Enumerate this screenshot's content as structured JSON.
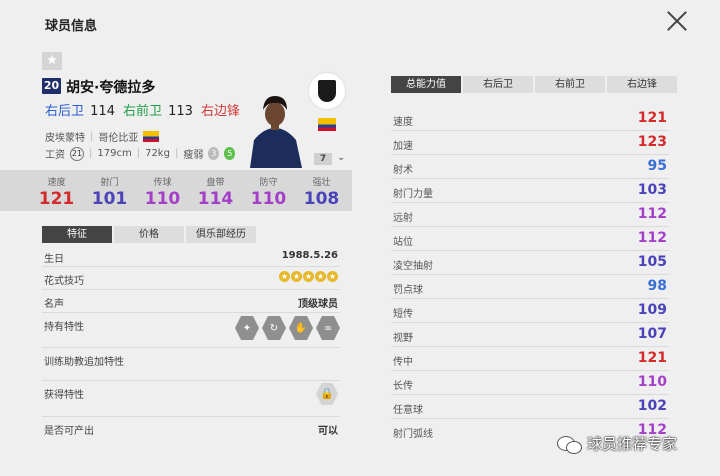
{
  "header": {
    "title": "球员信息"
  },
  "player": {
    "number": "20",
    "name": "胡安·夸德拉多",
    "positions": [
      {
        "label": "右后卫",
        "value": "114"
      },
      {
        "label": "右前卫",
        "value": "113"
      },
      {
        "label": "右边锋",
        "value": "112"
      }
    ],
    "club": "皮埃蒙特",
    "nationality": "哥伦比亚",
    "wage_label": "工资",
    "wage": "21",
    "height": "179cm",
    "weight": "72kg",
    "body_type": "瘦弱",
    "weak_foot": "3",
    "strong_foot": "5",
    "level": "7"
  },
  "stats": [
    {
      "label": "速度",
      "value": "121",
      "color": "#d32a2a"
    },
    {
      "label": "射门",
      "value": "101",
      "color": "#4a44b8"
    },
    {
      "label": "传球",
      "value": "110",
      "color": "#a43fc8"
    },
    {
      "label": "盘带",
      "value": "114",
      "color": "#a43fc8"
    },
    {
      "label": "防守",
      "value": "110",
      "color": "#a43fc8"
    },
    {
      "label": "强壮",
      "value": "108",
      "color": "#4a44b8"
    }
  ],
  "left_tabs": [
    "特征",
    "价格",
    "俱乐部经历"
  ],
  "details": {
    "birthday_label": "生日",
    "birthday": "1988.5.26",
    "skill_label": "花式技巧",
    "skill_stars": 5,
    "reputation_label": "名声",
    "reputation": "顶级球员",
    "traits_label": "持有特性",
    "coach_traits_label": "训练助教追加特性",
    "obtain_label": "获得特性",
    "producible_label": "是否可产出",
    "producible": "可以"
  },
  "right_tabs": [
    "总能力值",
    "右后卫",
    "右前卫",
    "右边锋"
  ],
  "attributes": [
    {
      "label": "速度",
      "value": "121",
      "color": "#d32a2a"
    },
    {
      "label": "加速",
      "value": "123",
      "color": "#d32a2a"
    },
    {
      "label": "射术",
      "value": "95",
      "color": "#3a6fd8"
    },
    {
      "label": "射门力量",
      "value": "103",
      "color": "#4a44b8"
    },
    {
      "label": "远射",
      "value": "112",
      "color": "#a43fc8"
    },
    {
      "label": "站位",
      "value": "112",
      "color": "#a43fc8"
    },
    {
      "label": "凌空抽射",
      "value": "105",
      "color": "#4a44b8"
    },
    {
      "label": "罚点球",
      "value": "98",
      "color": "#3a6fd8"
    },
    {
      "label": "短传",
      "value": "109",
      "color": "#4a44b8"
    },
    {
      "label": "视野",
      "value": "107",
      "color": "#4a44b8"
    },
    {
      "label": "传中",
      "value": "121",
      "color": "#d32a2a"
    },
    {
      "label": "长传",
      "value": "110",
      "color": "#a43fc8"
    },
    {
      "label": "任意球",
      "value": "102",
      "color": "#4a44b8"
    },
    {
      "label": "射门弧线",
      "value": "112",
      "color": "#a43fc8"
    }
  ],
  "watermark": "球员推荐专家"
}
